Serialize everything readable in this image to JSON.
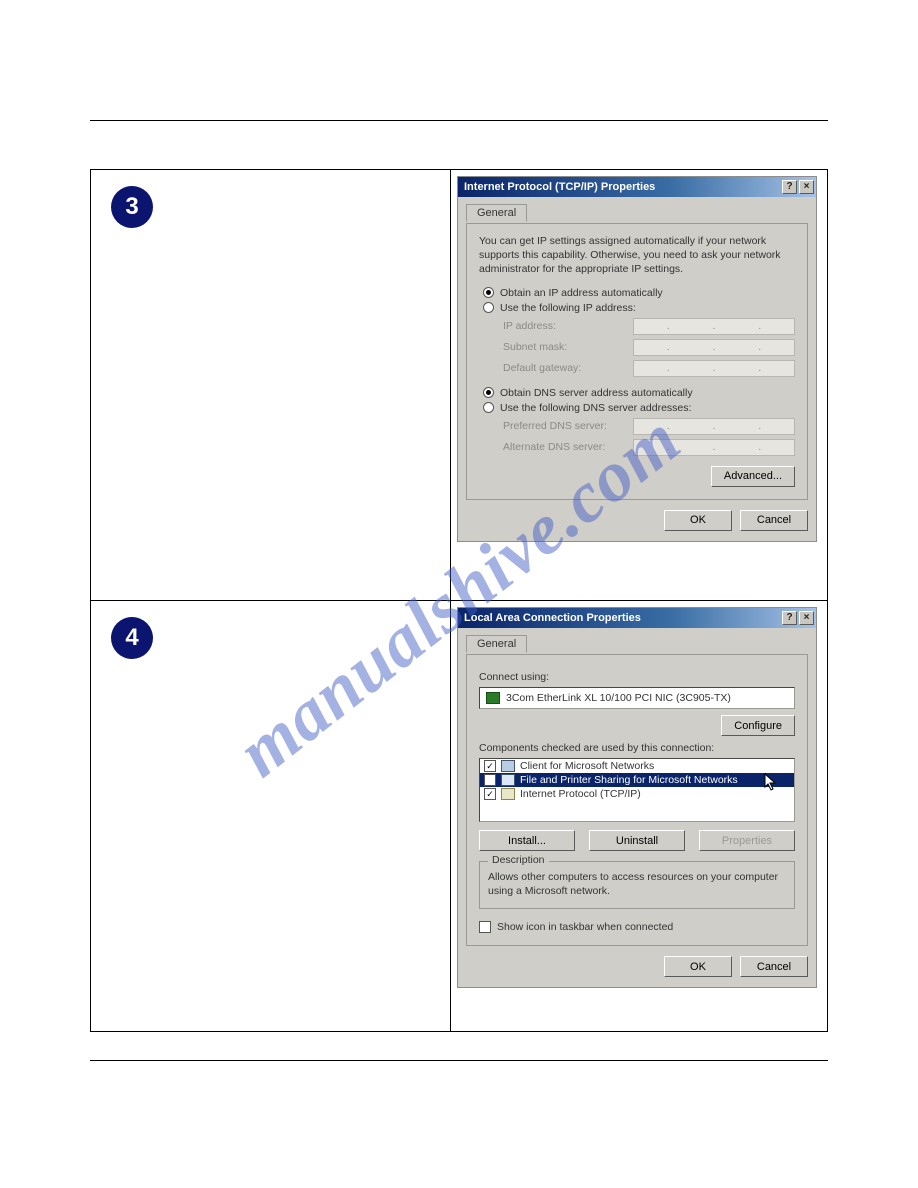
{
  "watermark": "manualshive.com",
  "step3": {
    "badge": "3"
  },
  "step4": {
    "badge": "4"
  },
  "dialog1": {
    "title": "Internet Protocol (TCP/IP) Properties",
    "help_btn": "?",
    "close_btn": "×",
    "tab_general": "General",
    "infotext": "You can get IP settings assigned automatically if your network supports this capability. Otherwise, you need to ask your network administrator for the appropriate IP settings.",
    "r_obtain_ip": "Obtain an IP address automatically",
    "r_use_ip": "Use the following IP address:",
    "label_ip": "IP address:",
    "label_subnet": "Subnet mask:",
    "label_gateway": "Default gateway:",
    "r_obtain_dns": "Obtain DNS server address automatically",
    "r_use_dns": "Use the following DNS server addresses:",
    "label_pref_dns": "Preferred DNS server:",
    "label_alt_dns": "Alternate DNS server:",
    "btn_advanced": "Advanced...",
    "btn_ok": "OK",
    "btn_cancel": "Cancel"
  },
  "dialog2": {
    "title": "Local Area Connection Properties",
    "help_btn": "?",
    "close_btn": "×",
    "tab_general": "General",
    "label_connect_using": "Connect using:",
    "adapter": "3Com EtherLink XL 10/100 PCI NIC (3C905-TX)",
    "btn_configure": "Configure",
    "label_components": "Components checked are used by this connection:",
    "items": [
      {
        "checked": true,
        "text": "Client for Microsoft Networks"
      },
      {
        "checked": false,
        "text": "File and Printer Sharing for Microsoft Networks",
        "selected": true
      },
      {
        "checked": true,
        "text": "Internet Protocol (TCP/IP)"
      }
    ],
    "btn_install": "Install...",
    "btn_uninstall": "Uninstall",
    "btn_properties": "Properties",
    "group_desc_title": "Description",
    "group_desc_text": "Allows other computers to access resources on your computer using a Microsoft network.",
    "chk_show_icon": "Show icon in taskbar when connected",
    "btn_ok": "OK",
    "btn_cancel": "Cancel"
  }
}
